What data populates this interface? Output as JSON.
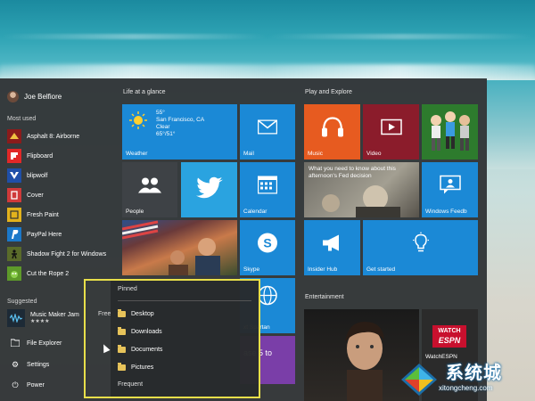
{
  "user": {
    "name": "Joe Belfiore"
  },
  "left": {
    "most_used_label": "Most used",
    "apps": [
      {
        "label": "Asphalt 8: Airborne",
        "icon": "asphalt-icon",
        "color": "#8a1b1b"
      },
      {
        "label": "Flipboard",
        "icon": "flipboard-icon",
        "color": "#e12828"
      },
      {
        "label": "blipwolf",
        "icon": "blipwolf-icon",
        "color": "#1f4fa8"
      },
      {
        "label": "Cover",
        "icon": "cover-icon",
        "color": "#d03a3a"
      },
      {
        "label": "Fresh Paint",
        "icon": "fresh-paint-icon",
        "color": "#e3b21c"
      },
      {
        "label": "PayPal Here",
        "icon": "paypal-icon",
        "color": "#1b78c9"
      },
      {
        "label": "Shadow Fight 2 for Windows",
        "icon": "shadow-fight-icon",
        "color": "#5a6b2a"
      },
      {
        "label": "Cut the Rope 2",
        "icon": "cut-the-rope-icon",
        "color": "#5e9a2a"
      }
    ],
    "suggested_label": "Suggested",
    "suggested_app": {
      "label": "Music Maker Jam",
      "rating": "★★★★",
      "price": "Free"
    },
    "system": [
      {
        "label": "File Explorer",
        "icon": "folder-icon"
      },
      {
        "label": "Settings",
        "icon": "gear-icon"
      },
      {
        "label": "Power",
        "icon": "power-icon"
      }
    ]
  },
  "groups": {
    "life": "Life at a glance",
    "play": "Play and Explore",
    "entertainment": "Entertainment"
  },
  "tiles": {
    "weather": {
      "temp": "55°",
      "city": "San Francisco, CA",
      "cond": "Clear",
      "range": "65°/51°",
      "label": "Weather"
    },
    "mail": "Mail",
    "people": "People",
    "calendar": "Calendar",
    "skype": "Skype",
    "spartan_line1": "xt Spartan",
    "spartan_line2": "ase 5 to",
    "music": "Music",
    "video": "Video",
    "news": "What you need to know about this afternoon's Fed decision",
    "windows_feedback": "Windows Feedb",
    "insider_hub": "Insider Hub",
    "get_started": "Get started",
    "espn_top": "WATCH",
    "espn_bottom": "ESPN",
    "watchespn": "WatchESPN"
  },
  "jump_list": {
    "pinned_label": "Pinned",
    "items": [
      "Desktop",
      "Downloads",
      "Documents",
      "Pictures"
    ],
    "frequent_label": "Frequent"
  },
  "watermark": {
    "title": "系统城",
    "url": "xitongcheng.com"
  },
  "colors": {
    "accent": "#1b89d6",
    "music_orange": "#e75b20",
    "video_red": "#8b1c2b",
    "xbox_green": "#2d7b2d",
    "highlight_yellow": "#e8df4a"
  }
}
